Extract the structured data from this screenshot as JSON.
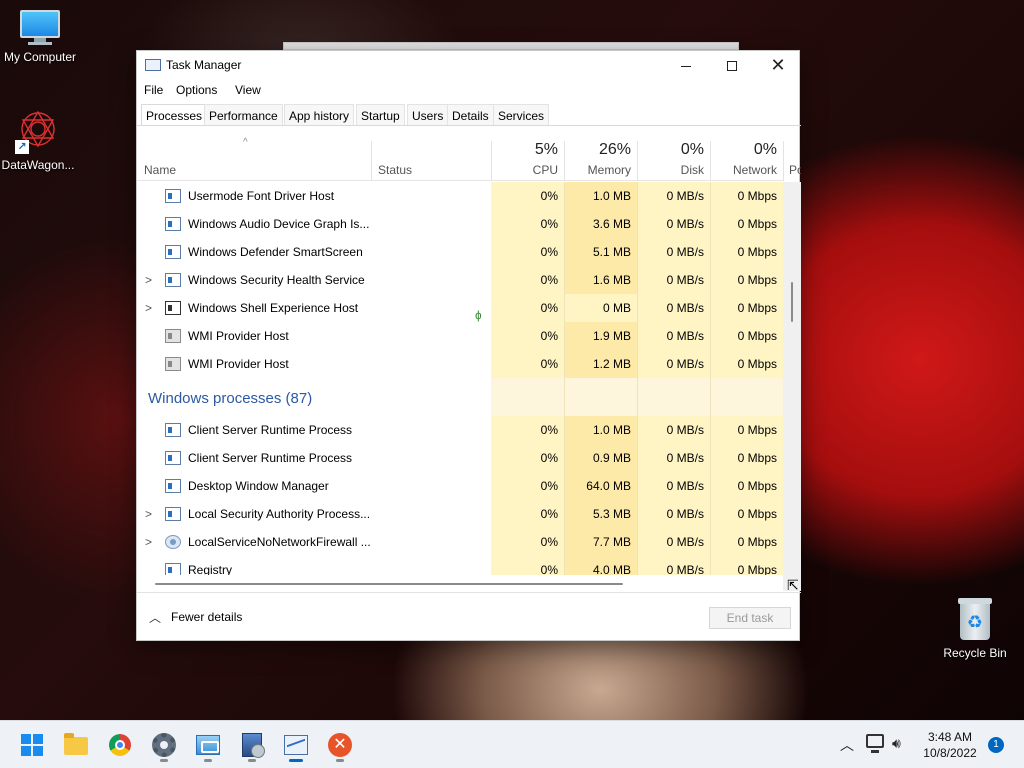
{
  "desktop": {
    "icons": [
      {
        "label": "My Computer"
      },
      {
        "label": "DataWagon..."
      },
      {
        "label": "Recycle Bin"
      }
    ]
  },
  "window": {
    "title": "Task Manager",
    "menu": [
      "File",
      "Options",
      "View"
    ],
    "tabs": [
      "Processes",
      "Performance",
      "App history",
      "Startup",
      "Users",
      "Details",
      "Services"
    ],
    "active_tab": "Processes"
  },
  "columns": {
    "name": "Name",
    "status": "Status",
    "cpu": {
      "pct": "5%",
      "label": "CPU"
    },
    "memory": {
      "pct": "26%",
      "label": "Memory"
    },
    "disk": {
      "pct": "0%",
      "label": "Disk"
    },
    "network": {
      "pct": "0%",
      "label": "Network"
    },
    "power_partial": "Po"
  },
  "rows_top": [
    {
      "name": "Usermode Font Driver Host",
      "cpu": "0%",
      "memory": "1.0 MB",
      "disk": "0 MB/s",
      "network": "0 Mbps"
    },
    {
      "name": "Windows Audio Device Graph Is...",
      "cpu": "0%",
      "memory": "3.6 MB",
      "disk": "0 MB/s",
      "network": "0 Mbps"
    },
    {
      "name": "Windows Defender SmartScreen",
      "cpu": "0%",
      "memory": "5.1 MB",
      "disk": "0 MB/s",
      "network": "0 Mbps"
    },
    {
      "name": "Windows Security Health Service",
      "cpu": "0%",
      "memory": "1.6 MB",
      "disk": "0 MB/s",
      "network": "0 Mbps"
    },
    {
      "name": "Windows Shell Experience Host",
      "cpu": "0%",
      "memory": "0 MB",
      "disk": "0 MB/s",
      "network": "0 Mbps"
    },
    {
      "name": "WMI Provider Host",
      "cpu": "0%",
      "memory": "1.9 MB",
      "disk": "0 MB/s",
      "network": "0 Mbps"
    },
    {
      "name": "WMI Provider Host",
      "cpu": "0%",
      "memory": "1.2 MB",
      "disk": "0 MB/s",
      "network": "0 Mbps"
    }
  ],
  "group": {
    "title": "Windows processes (87)"
  },
  "rows_bottom": [
    {
      "name": "Client Server Runtime Process",
      "cpu": "0%",
      "memory": "1.0 MB",
      "disk": "0 MB/s",
      "network": "0 Mbps"
    },
    {
      "name": "Client Server Runtime Process",
      "cpu": "0%",
      "memory": "0.9 MB",
      "disk": "0 MB/s",
      "network": "0 Mbps"
    },
    {
      "name": "Desktop Window Manager",
      "cpu": "0%",
      "memory": "64.0 MB",
      "disk": "0 MB/s",
      "network": "0 Mbps"
    },
    {
      "name": "Local Security Authority Process...",
      "cpu": "0%",
      "memory": "5.3 MB",
      "disk": "0 MB/s",
      "network": "0 Mbps"
    },
    {
      "name": "LocalServiceNoNetworkFirewall ...",
      "cpu": "0%",
      "memory": "7.7 MB",
      "disk": "0 MB/s",
      "network": "0 Mbps"
    },
    {
      "name": "Registry",
      "cpu": "0%",
      "memory": "4.0 MB",
      "disk": "0 MB/s",
      "network": "0 Mbps"
    }
  ],
  "footer": {
    "fewer_details": "Fewer details",
    "end_task": "End task"
  },
  "taskbar": {
    "time": "3:48 AM",
    "date": "10/8/2022",
    "notification_count": "1"
  },
  "colors": {
    "accent": "#0067c0",
    "group_title": "#2a5aa5",
    "heat_light": "#fff4c4",
    "heat_medium": "#fde9a8"
  }
}
